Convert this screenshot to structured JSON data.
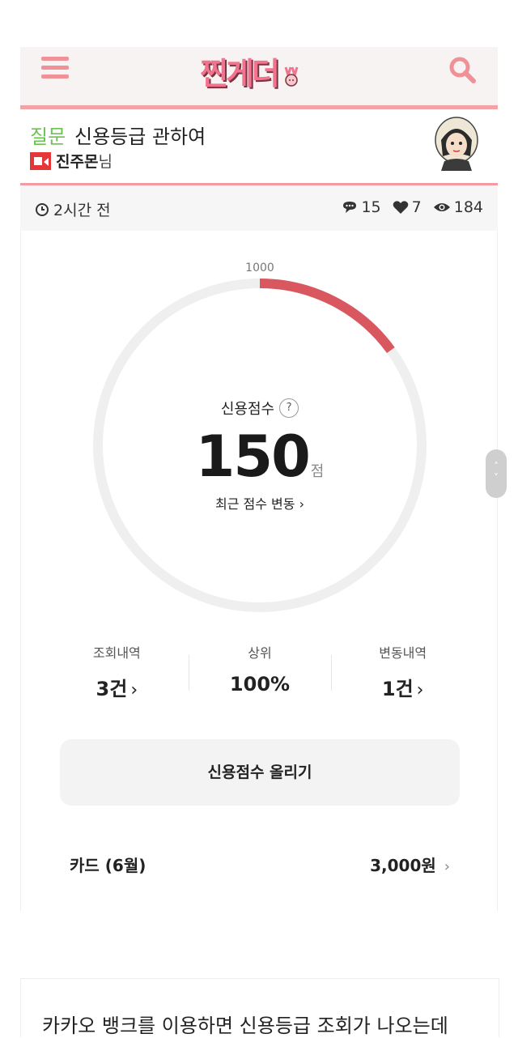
{
  "header": {
    "logo": "찐게더",
    "menu_icon": "hamburger-icon",
    "search_icon": "search-icon"
  },
  "post": {
    "tag": "질문",
    "title": "신용등급 관하여",
    "author": "진주몬",
    "author_suffix": "님",
    "time": "2시간 전",
    "comments": "15",
    "likes": "7",
    "views": "184"
  },
  "credit": {
    "max_label": "1000",
    "title": "신용점수",
    "help": "?",
    "score": "150",
    "unit": "점",
    "gauge_fraction": 0.15,
    "recent_change": "최근 점수 변동",
    "stats": [
      {
        "label": "조회내역",
        "value": "3건"
      },
      {
        "label": "상위",
        "value": "100%"
      },
      {
        "label": "변동내역",
        "value": "1건"
      }
    ],
    "raise_button": "신용점수 올리기",
    "card_label": "카드 (6월)",
    "card_amount": "3,000원"
  },
  "body_text": "카카오 뱅크를 이용하면 신용등급 조회가 나오는데",
  "colors": {
    "accent": "#d9575e",
    "tag_green": "#6cc34f",
    "pink": "#f3a3a6"
  }
}
